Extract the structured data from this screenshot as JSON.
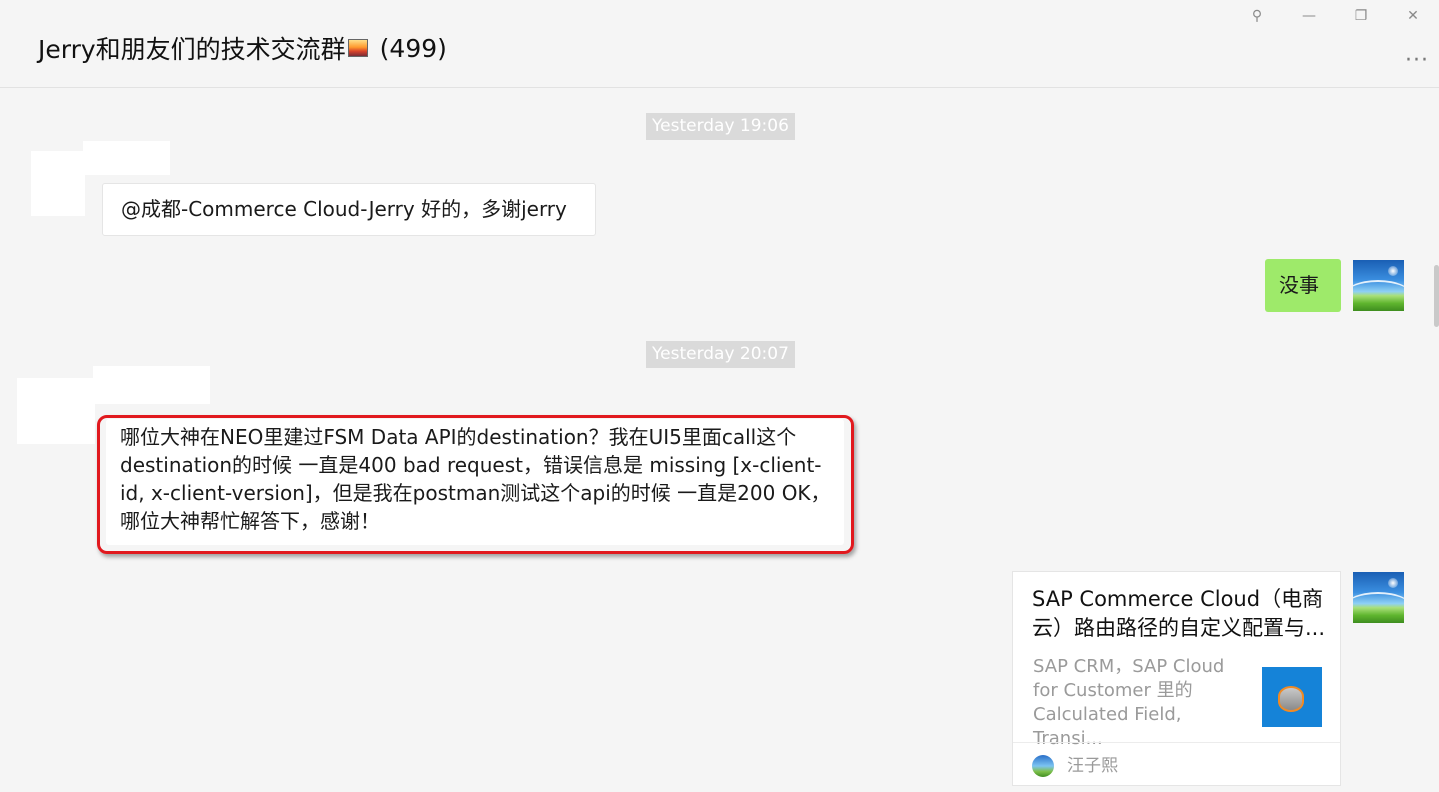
{
  "window": {
    "title": "Jerry和朋友们的技术交流群",
    "member_count": "(499)",
    "buttons": {
      "pin": "⚲",
      "minimize": "—",
      "restore": "❐",
      "close": "✕"
    },
    "more": "···"
  },
  "messages": {
    "time1": "Yesterday 19:06",
    "msg1": "@成都-Commerce Cloud-Jerry 好的，多谢jerry",
    "msg2": "没事",
    "time2": "Yesterday 20:07",
    "msg3": "哪位大神在NEO里建过FSM Data API的destination？我在UI5里面call这个destination的时候 一直是400 bad request，错误信息是 missing [x-client-id, x-client-version]，但是我在postman测试这个api的时候 一直是200 OK，哪位大神帮忙解答下，感谢！",
    "card": {
      "title": "SAP Commerce Cloud（电商云）路由路径的自定义配置与...",
      "description": "SAP CRM，SAP Cloud for Customer 里的 Calculated Field, Transi...",
      "source": "汪子熙"
    }
  },
  "colors": {
    "own_bubble": "#9eea6a",
    "highlight_border": "#e1191e",
    "time_badge": "#dadada"
  },
  "icons": {
    "pin": "pin-icon",
    "minimize": "minimize-icon",
    "restore": "restore-icon",
    "close": "close-icon",
    "more": "more-icon",
    "avatar": "landscape-avatar",
    "title_emoji": "sunset-emoji-icon"
  }
}
